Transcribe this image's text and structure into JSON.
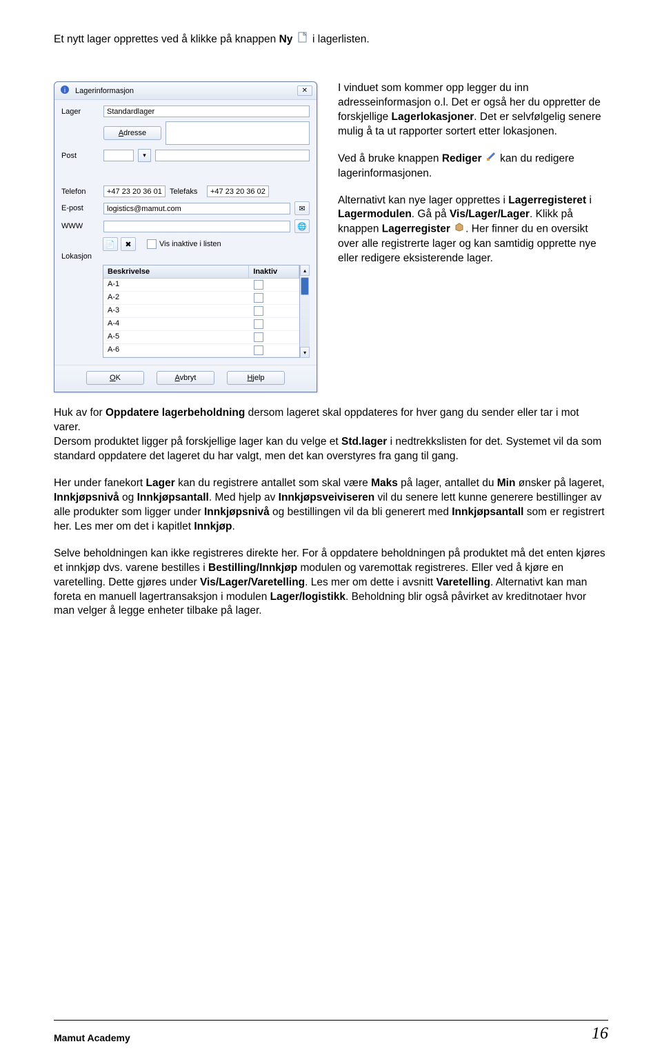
{
  "intro": {
    "text_before": "Et nytt lager opprettes ved å klikke på knappen ",
    "bold1": "Ny",
    "text_after": " i lagerlisten."
  },
  "dialog": {
    "title": "Lagerinformasjon",
    "labels": {
      "lager": "Lager",
      "adresse": "Adresse",
      "post": "Post",
      "telefon": "Telefon",
      "telefaks": "Telefaks",
      "epost": "E-post",
      "www": "WWW",
      "lokasjon": "Lokasjon"
    },
    "values": {
      "lager": "Standardlager",
      "telefon": "+47 23 20 36 01",
      "telefaks": "+47 23 20 36 02",
      "epost": "logistics@mamut.com",
      "www": ""
    },
    "inactive_check": "Vis inaktive i listen",
    "list": {
      "col1": "Beskrivelse",
      "col2": "Inaktiv",
      "rows": [
        "A-1",
        "A-2",
        "A-3",
        "A-4",
        "A-5",
        "A-6"
      ]
    },
    "buttons": {
      "adresse_btn": "Adresse",
      "ok": "OK",
      "cancel": "Avbryt",
      "help": "Hjelp"
    }
  },
  "right_col": {
    "p1a": "I vinduet som kommer opp legger du inn adresseinformasjon o.l. Det er også her du oppretter de forskjellige ",
    "p1b": "Lagerlokasjoner",
    "p1c": ". Det er selvfølgelig senere mulig å ta ut rapporter sortert etter lokasjonen.",
    "p2a": "Ved å bruke knappen ",
    "p2b": "Rediger",
    "p2c": " kan du redigere lagerinformasjonen.",
    "p3a": "Alternativt kan nye lager opprettes i ",
    "p3b": "Lagerregisteret",
    "p3c": " i ",
    "p3d": "Lagermodulen",
    "p3e": ". Gå på ",
    "p3f": "Vis/Lager/Lager",
    "p3g": ". Klikk på knappen ",
    "p3h": "Lagerregister",
    "p3i": ". Her finner du en oversikt over alle registrerte lager og kan samtidig opprette nye eller redigere eksisterende lager."
  },
  "body": {
    "p1a": "Huk av for ",
    "p1b": "Oppdatere lagerbeholdning",
    "p1c": " dersom lageret skal oppdateres for hver gang du sender eller tar i mot varer.",
    "p2a": "Dersom produktet ligger på forskjellige lager kan du velge et ",
    "p2b": "Std.lager",
    "p2c": " i nedtrekkslisten for det. Systemet vil da som standard oppdatere det lageret du har valgt, men det kan overstyres fra gang til gang.",
    "p3a": "Her under fanekort ",
    "p3b": "Lager",
    "p3c": " kan du registrere antallet som skal være ",
    "p3d": "Maks",
    "p3e": " på lager, antallet du ",
    "p3f": "Min",
    "p3g": " ønsker på lageret, ",
    "p3h": "Innkjøpsnivå",
    "p3i": " og ",
    "p3j": "Innkjøpsantall",
    "p3k": ". Med hjelp av ",
    "p3l": "Innkjøpsveiviseren",
    "p3m": " vil du senere lett kunne generere bestillinger av alle produkter som ligger under ",
    "p3n": "Innkjøpsnivå",
    "p3o": " og bestillingen vil da bli generert med ",
    "p3p": "Innkjøpsantall",
    "p3q": " som er registrert her. Les mer om det i kapitlet ",
    "p3r": "Innkjøp",
    "p3s": ".",
    "p4a": "Selve beholdningen kan ikke registreres direkte her. For å oppdatere beholdningen på produktet må det enten kjøres et innkjøp dvs. varene bestilles i ",
    "p4b": "Bestilling/Innkjøp",
    "p4c": " modulen og varemottak registreres. Eller ved å kjøre en varetelling. Dette gjøres under ",
    "p4d": "Vis/Lager/Varetelling",
    "p4e": ". Les mer om dette i avsnitt ",
    "p4f": "Varetelling",
    "p4g": ". Alternativt kan man foreta en manuell lagertransaksjon i modulen ",
    "p4h": "Lager/logistikk",
    "p4i": ". Beholdning blir også påvirket av kreditnotaer hvor man velger å legge enheter tilbake på lager."
  },
  "footer": {
    "left": "Mamut Academy",
    "page": "16"
  }
}
